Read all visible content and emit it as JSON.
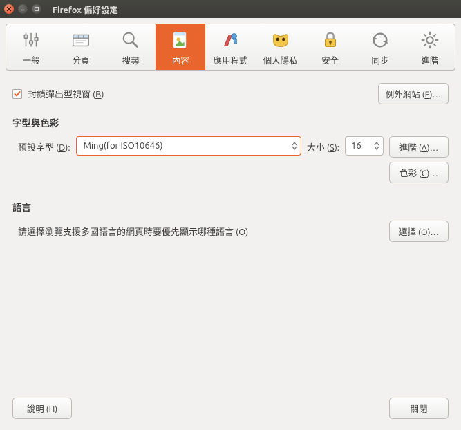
{
  "window": {
    "title": "Firefox 偏好設定"
  },
  "tabs": {
    "general": "一般",
    "tabs": "分頁",
    "search": "搜尋",
    "content": "內容",
    "applications": "應用程式",
    "privacy": "個人隱私",
    "security": "安全",
    "sync": "同步",
    "advanced": "進階"
  },
  "popup": {
    "block_label": "封鎖彈出型視窗 (B)",
    "exceptions_label": "例外網站 (E)…"
  },
  "fonts": {
    "heading": "字型與色彩",
    "default_font_label": "預設字型 (D):",
    "default_font_value": "Ming(for ISO10646)",
    "size_label": "大小 (S):",
    "size_value": "16",
    "advanced_label": "進階 (A)…",
    "colors_label": "色彩 (C)…"
  },
  "lang": {
    "heading": "語言",
    "desc": "請選擇瀏覽支援多國語言的網頁時要優先顯示哪種語言 (O)",
    "choose_label": "選擇 (O)…"
  },
  "bottom": {
    "help": "說明 (H)",
    "close": "關閉"
  }
}
